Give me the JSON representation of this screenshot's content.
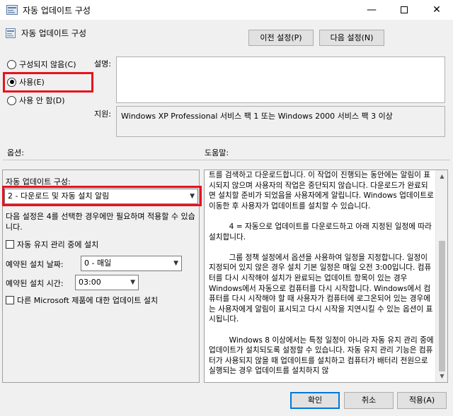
{
  "window": {
    "title": "자동 업데이트 구성",
    "minimize": "—",
    "close": "✕"
  },
  "header": {
    "policy_title": "자동 업데이트 구성",
    "prev_label": "이전 설정(P)",
    "next_label": "다음 설정(N)"
  },
  "state": {
    "options": [
      {
        "label": "구성되지 않음(C)",
        "selected": false
      },
      {
        "label": "사용(E)",
        "selected": true
      },
      {
        "label": "사용 안 함(D)",
        "selected": false
      }
    ]
  },
  "description": {
    "label": "설명:",
    "value": ""
  },
  "support": {
    "label": "지원:",
    "value": "Windows XP Professional 서비스 팩 1 또는 Windows 2000 서비스 팩 3 이상"
  },
  "sections": {
    "options_label": "옵션:",
    "help_label": "도움말:"
  },
  "options_panel": {
    "configure_label": "자동 업데이트 구성:",
    "configure_value": "2 - 다운로드 및 자동 설치 알림",
    "note": "다음 설정은 4를 선택한 경우에만 필요하며 적용할 수 있습니다.",
    "maintenance_label": "자동 유지 관리 중에 설치",
    "install_day_label": "예약된 설치 날짜:",
    "install_day_value": "0 - 매일",
    "install_time_label": "예약된 설치 시간:",
    "install_time_value": "03:00",
    "other_products_label": "다른 Microsoft 제품에 대한 업데이트 설치"
  },
  "help": {
    "paragraphs": [
      "트를 검색하고 다운로드합니다. 이 작업이 진행되는 동안에는 알림이 표시되지 않으며 사용자의 작업은 중단되지 않습니다. 다운로드가 완료되면 설치할 준비가 되었음을 사용자에게 알립니다. Windows 업데이트로 이동한 후 사용자가 업데이트를 설치할 수 있습니다.",
      "4 = 자동으로 업데이트를 다운로드하고 아래 지정된 일정에 따라 설치합니다.",
      "그룹 정책 설정에서 옵션을 사용하여 일정을 지정합니다. 일정이 지정되어 있지 않은 경우 설치 기본 일정은 매일 오전 3:00입니다. 컴퓨터를 다시 시작해야 설치가 완료되는 업데이트 항목이 있는 경우 Windows에서 자동으로 컴퓨터를 다시 시작합니다. Windows에서 컴퓨터를 다시 시작해야 할 때 사용자가 컴퓨터에 로그온되어 있는 경우에는 사용자에게 알림이 표시되고 다시 시작을 지연시킬 수 있는 옵션이 표시됩니다.",
      "Windows 8 이상에서는 특정 일정이 아니라 자동 유지 관리 중에 업데이트가 설치되도록 설정할 수 있습니다. 자동 유지 관리 기능은 컴퓨터가 사용되지 않을 때 업데이트를 설치하고 컴퓨터가 배터리 전원으로 실행되는 경우 업데이트를 설치하지 않"
    ]
  },
  "footer": {
    "ok_label": "확인",
    "cancel_label": "취소",
    "apply_label": "적용(A)"
  }
}
